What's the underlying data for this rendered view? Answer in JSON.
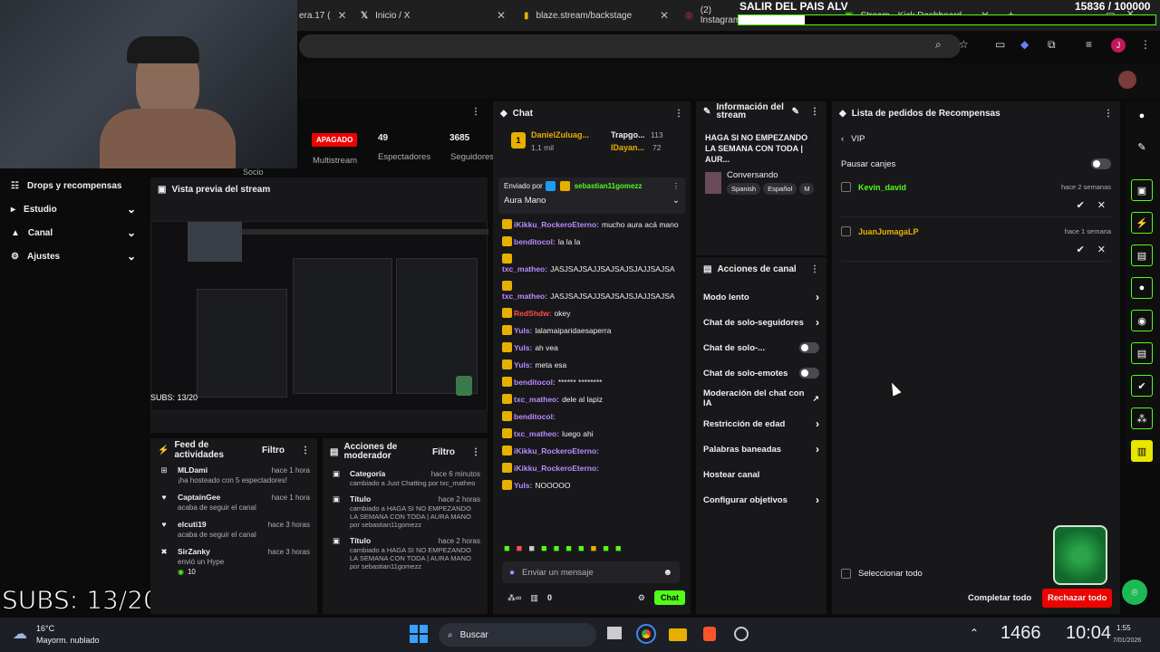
{
  "browser": {
    "tabs": [
      {
        "label": "era.17 (",
        "icon": "tab-icon"
      },
      {
        "label": "Inicio / X",
        "icon": "x-logo-icon"
      },
      {
        "label": "blaze.stream/backstage",
        "icon": "bookmark-icon"
      },
      {
        "label": "(2) Instagram",
        "icon": "instagram-icon"
      },
      {
        "label": "Stream - Kick Dashboard",
        "icon": "kick-icon"
      }
    ]
  },
  "overlay": {
    "goal_title": "SALIR DEL PAIS ALV",
    "goal_count": "15836 / 100000",
    "goal_progress": 0.158,
    "subs": "SUBS: 13/20",
    "preview_subs": "SUBS: 13/20"
  },
  "dashboard": {
    "status": "APAGADO",
    "multistream_label": "Multistream",
    "viewers_value": "49",
    "viewers_label": "Espectadores",
    "followers_value": "3685",
    "followers_label": "Seguidores",
    "socio": "Socio",
    "nav": [
      {
        "label": "Drops y recompensas",
        "icon": "gift-icon",
        "chevron": false
      },
      {
        "label": "Estudio",
        "icon": "studio-icon",
        "chevron": true
      },
      {
        "label": "Canal",
        "icon": "channel-icon",
        "chevron": true
      },
      {
        "label": "Ajustes",
        "icon": "gear-icon",
        "chevron": true
      }
    ],
    "preview_title": "Vista previa del stream"
  },
  "chat": {
    "title": "Chat",
    "top_user": "DanielZuluag...",
    "top_user_sub": "1,1 mil",
    "top2_user": "Trapgo...",
    "top2_count": "113",
    "top3_user": "IDayan...",
    "top3_count": "72",
    "pinned_by_label": "Enviado por",
    "pinned_user": "sebastian11gomezz",
    "pinned_msg": "Aura Mano",
    "messages": [
      {
        "user": "iKikku_RockeroEterno:",
        "text": "mucho aura acá mano",
        "color": "#b98bff"
      },
      {
        "user": "benditocol:",
        "text": "la la la",
        "color": "#b98bff"
      },
      {
        "user": "txc_matheo:",
        "text": "JASJSAJSAJJSAJSAJSJAJJSAJSA",
        "color": "#b98bff"
      },
      {
        "user": "txc_matheo:",
        "text": "JASJSAJSAJJSAJSAJSJAJJSAJSA",
        "color": "#b98bff"
      },
      {
        "user": "RedShdw:",
        "text": "okey",
        "color": "#ff4d4d"
      },
      {
        "user": "Yuls:",
        "text": "lalamaiparidaesaperra",
        "color": "#b98bff"
      },
      {
        "user": "Yuls:",
        "text": "ah vea",
        "color": "#b98bff"
      },
      {
        "user": "Yuls:",
        "text": "meta esa",
        "color": "#b98bff"
      },
      {
        "user": "benditocol:",
        "text": "****** ********",
        "color": "#b98bff"
      },
      {
        "user": "txc_matheo:",
        "text": "dele al lapiz",
        "color": "#b98bff"
      },
      {
        "user": "benditocol:",
        "text": "",
        "color": "#b98bff"
      },
      {
        "user": "txc_matheo:",
        "text": "luego ahi",
        "color": "#b98bff"
      },
      {
        "user": "iKikku_RockeroEterno:",
        "text": "",
        "color": "#b98bff"
      },
      {
        "user": "iKikku_RockeroEterno:",
        "text": "",
        "color": "#b98bff"
      },
      {
        "user": "Yuls:",
        "text": "NOOOOO",
        "color": "#b98bff"
      }
    ],
    "input_placeholder": "Enviar un mensaje",
    "points": "0",
    "send_label": "Chat"
  },
  "stream_info": {
    "title": "Información del stream",
    "stream_title": "HAGA SI NO EMPEZANDO LA SEMANA CON TODA | AUR...",
    "category": "Conversando",
    "tags": [
      "Spanish",
      "Español",
      "M"
    ]
  },
  "channel_actions": {
    "title": "Acciones de canal",
    "items": [
      {
        "label": "Modo lento",
        "control": "chevron"
      },
      {
        "label": "Chat de solo-seguidores",
        "control": "chevron"
      },
      {
        "label": "Chat de solo-...",
        "control": "toggle"
      },
      {
        "label": "Chat de solo-emotes",
        "control": "toggle"
      },
      {
        "label": "Moderación del chat con IA",
        "control": "external"
      },
      {
        "label": "Restricción de edad",
        "control": "chevron"
      },
      {
        "label": "Palabras baneadas",
        "control": "chevron"
      },
      {
        "label": "Hostear canal",
        "control": "none"
      },
      {
        "label": "Configurar objetivos",
        "control": "chevron"
      }
    ]
  },
  "rewards": {
    "title": "Lista de pedidos de Recompensas",
    "back_label": "VIP",
    "pause_label": "Pausar canjes",
    "items": [
      {
        "user": "Kevin_david",
        "time": "hace 2 semanas",
        "color": "#53fc18"
      },
      {
        "user": "JuanJumagaLP",
        "time": "hace 1 semana",
        "color": "#e7b000"
      }
    ],
    "select_all": "Seleccionar todo",
    "complete_all": "Completar todo",
    "reject_all": "Rechazar todo"
  },
  "activity": {
    "title": "Feed de actividades",
    "filter": "Filtro",
    "items": [
      {
        "user": "MLDami",
        "time": "hace 1 hora",
        "line1": "¡ha hosteado con 5 espectadores!",
        "icon": "host-icon"
      },
      {
        "user": "CaptainGee",
        "time": "hace 1 hora",
        "line1": "acaba de seguir el canal",
        "icon": "heart-icon"
      },
      {
        "user": "elcuti19",
        "time": "hace 3 horas",
        "line1": "acaba de seguir el canal",
        "icon": "heart-icon"
      },
      {
        "user": "SirZanky",
        "time": "hace 3 horas",
        "line1": "envió un Hype",
        "line2": "10",
        "icon": "hype-icon"
      }
    ]
  },
  "modactions": {
    "title": "Acciones de moderador",
    "filter": "Filtro",
    "items": [
      {
        "kind": "Categoría",
        "time": "hace 6 minutos",
        "text": "cambiado a Just Chatting por txc_matheo"
      },
      {
        "kind": "Título",
        "time": "hace 2 horas",
        "text": "cambiado a HAGA SI NO EMPEZANDO LA SEMANA CON TODA | AURA MANO por sebastian11gomezz"
      },
      {
        "kind": "Título",
        "time": "hace 2 horas",
        "text": "cambiado a HAGA SI NO EMPEZANDO LA SEMANA CON TODA | AURA MANO por sebastian11gomezz"
      }
    ]
  },
  "taskbar": {
    "weather_temp": "16°C",
    "weather_desc": "Mayorm. nublado",
    "search": "Buscar",
    "overlay_time": "10:04",
    "overlay_num": "1466",
    "clock_time": "1:55",
    "clock_date": "7/01/2026"
  }
}
